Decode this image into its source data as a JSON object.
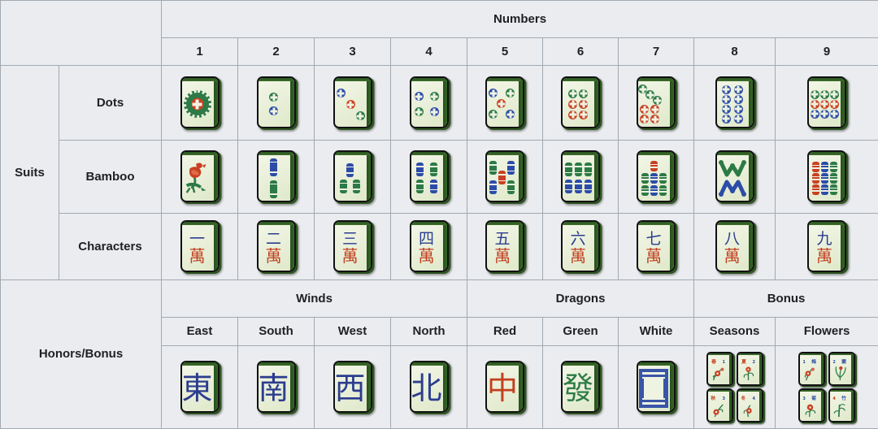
{
  "table": {
    "headers": {
      "numbers": "Numbers",
      "number_cols": [
        "1",
        "2",
        "3",
        "4",
        "5",
        "6",
        "7",
        "8",
        "9"
      ],
      "winds": "Winds",
      "dragons": "Dragons",
      "bonus": "Bonus",
      "honor_cols": [
        "East",
        "South",
        "West",
        "North",
        "Red",
        "Green",
        "White",
        "Seasons",
        "Flowers"
      ]
    },
    "row_groups": {
      "suits": "Suits",
      "honors_bonus": "Honors/Bonus"
    },
    "suit_rows": [
      {
        "label": "Dots"
      },
      {
        "label": "Bamboo"
      },
      {
        "label": "Characters"
      }
    ]
  },
  "tiles": {
    "dots": [
      {
        "n": "1",
        "name": "one-dot",
        "layout": "big-circle",
        "colors": [
          "green",
          "red"
        ]
      },
      {
        "n": "2",
        "name": "two-dot",
        "layout": "vertical-2",
        "colors": [
          "green",
          "blue"
        ]
      },
      {
        "n": "3",
        "name": "three-dot",
        "layout": "diagonal-3",
        "colors": [
          "blue",
          "red",
          "green"
        ]
      },
      {
        "n": "4",
        "name": "four-dot",
        "layout": "grid-2x2",
        "colors": [
          "blue",
          "green",
          "green",
          "blue"
        ]
      },
      {
        "n": "5",
        "name": "five-dot",
        "layout": "quincunx-5",
        "colors": [
          "blue",
          "green",
          "red",
          "green",
          "blue"
        ]
      },
      {
        "n": "6",
        "name": "six-dot",
        "layout": "rows-2-2-2",
        "colors": [
          "green",
          "green",
          "red",
          "red",
          "red",
          "red"
        ]
      },
      {
        "n": "7",
        "name": "seven-dot",
        "layout": "diag3-plus-4",
        "colors": [
          "green",
          "red"
        ]
      },
      {
        "n": "8",
        "name": "eight-dot",
        "layout": "grid-2x4",
        "colors": [
          "blue"
        ]
      },
      {
        "n": "9",
        "name": "nine-dot",
        "layout": "grid-3x3",
        "colors": [
          "green",
          "red",
          "blue"
        ]
      }
    ],
    "bamboo": [
      {
        "n": "1",
        "name": "one-bamboo",
        "layout": "bird",
        "colors": [
          "red",
          "green"
        ]
      },
      {
        "n": "2",
        "name": "two-bamboo",
        "layout": "vertical-2",
        "colors": [
          "blue",
          "green"
        ]
      },
      {
        "n": "3",
        "name": "three-bamboo",
        "layout": "one-over-two",
        "colors": [
          "blue",
          "green",
          "green"
        ]
      },
      {
        "n": "4",
        "name": "four-bamboo",
        "layout": "grid-2x2",
        "colors": [
          "blue",
          "green",
          "green",
          "blue"
        ]
      },
      {
        "n": "5",
        "name": "five-bamboo",
        "layout": "quincunx-5",
        "colors": [
          "green",
          "blue",
          "red",
          "blue",
          "green"
        ]
      },
      {
        "n": "6",
        "name": "six-bamboo",
        "layout": "rows-3-3",
        "colors": [
          "green",
          "blue"
        ]
      },
      {
        "n": "7",
        "name": "seven-bamboo",
        "layout": "one-over-six",
        "colors": [
          "red",
          "green",
          "blue"
        ]
      },
      {
        "n": "8",
        "name": "eight-bamboo",
        "layout": "w-over-m",
        "colors": [
          "green",
          "blue"
        ]
      },
      {
        "n": "9",
        "name": "nine-bamboo",
        "layout": "cols-3x3",
        "colors": [
          "red",
          "blue",
          "green"
        ]
      }
    ],
    "characters": [
      {
        "n": "1",
        "name": "one-character",
        "top": "一",
        "bottom": "萬"
      },
      {
        "n": "2",
        "name": "two-character",
        "top": "二",
        "bottom": "萬"
      },
      {
        "n": "3",
        "name": "three-character",
        "top": "三",
        "bottom": "萬"
      },
      {
        "n": "4",
        "name": "four-character",
        "top": "四",
        "bottom": "萬"
      },
      {
        "n": "5",
        "name": "five-character",
        "top": "五",
        "bottom": "萬"
      },
      {
        "n": "6",
        "name": "six-character",
        "top": "六",
        "bottom": "萬"
      },
      {
        "n": "7",
        "name": "seven-character",
        "top": "七",
        "bottom": "萬"
      },
      {
        "n": "8",
        "name": "eight-character",
        "top": "八",
        "bottom": "萬"
      },
      {
        "n": "9",
        "name": "nine-character",
        "top": "九",
        "bottom": "萬"
      }
    ],
    "winds": [
      {
        "label": "East",
        "name": "east-wind",
        "glyph": "東",
        "color": "blue"
      },
      {
        "label": "South",
        "name": "south-wind",
        "glyph": "南",
        "color": "blue"
      },
      {
        "label": "West",
        "name": "west-wind",
        "glyph": "西",
        "color": "blue"
      },
      {
        "label": "North",
        "name": "north-wind",
        "glyph": "北",
        "color": "blue"
      }
    ],
    "dragons": [
      {
        "label": "Red",
        "name": "red-dragon",
        "glyph": "中",
        "color": "red"
      },
      {
        "label": "Green",
        "name": "green-dragon",
        "glyph": "發",
        "color": "green"
      },
      {
        "label": "White",
        "name": "white-dragon",
        "glyph": "",
        "color": "blue"
      }
    ],
    "bonus": [
      {
        "label": "Seasons",
        "name": "season-tiles",
        "count": 4,
        "marks": [
          "春",
          "夏",
          "秋",
          "冬"
        ]
      },
      {
        "label": "Flowers",
        "name": "flower-tiles",
        "count": 4,
        "marks": [
          "梅",
          "蘭",
          "菊",
          "竹"
        ]
      }
    ]
  },
  "colors": {
    "tile_face": "#eef3e2",
    "tile_edge_green": "#2d5420",
    "cell_bg": "#eaecf0",
    "border": "#a2a9b1",
    "red": "#c2401f",
    "blue": "#2b3d8f",
    "green": "#2c7a45",
    "text": "#202122"
  }
}
